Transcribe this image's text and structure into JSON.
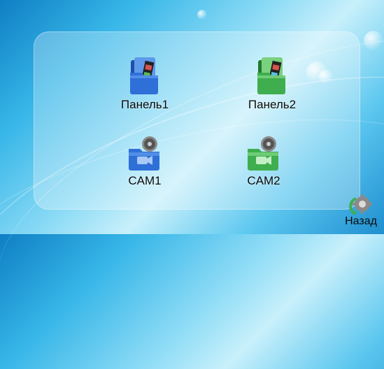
{
  "menu": {
    "items": [
      {
        "label": "Панель1",
        "icon": "film-folder-blue-icon"
      },
      {
        "label": "Панель2",
        "icon": "film-folder-green-icon"
      },
      {
        "label": "CAM1",
        "icon": "camera-folder-blue-icon"
      },
      {
        "label": "CAM2",
        "icon": "camera-folder-green-icon"
      }
    ]
  },
  "nav": {
    "back_label": "Назад",
    "back_icon": "gear-back-icon"
  },
  "colors": {
    "blue_folder": "#2f6fd8",
    "green_folder": "#3fae4e",
    "background": "#37b6e8"
  }
}
